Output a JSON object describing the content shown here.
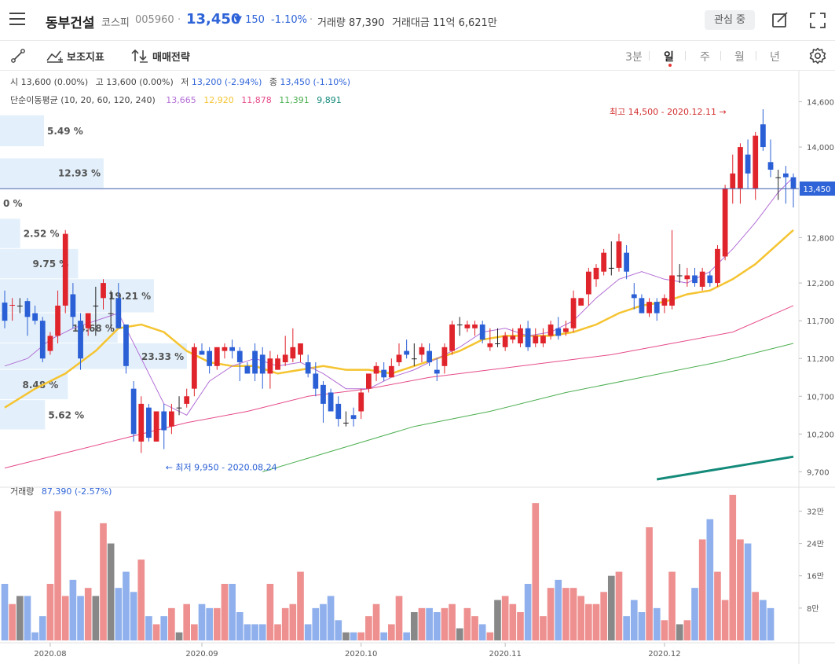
{
  "header": {
    "stock_name": "동부건설",
    "market": "코스피",
    "code": "005960",
    "separator": "·",
    "price": "13,450",
    "change": "▼ 150",
    "change_pct": "-1.10%",
    "volume": "거래량 87,390",
    "amount": "거래대금 11억 6,621만",
    "watch_label": "관심 중",
    "icons": [
      "menu-icon",
      "edit-icon",
      "fullscreen-icon"
    ]
  },
  "toolbar": {
    "indicator_label": "보조지표",
    "strategy_label": "매매전략",
    "timeframes": [
      "3분",
      "일",
      "주",
      "월",
      "년"
    ],
    "active_timeframe": "일",
    "icons": [
      "draw-line-icon",
      "indicator-icon",
      "strategy-icon",
      "gear-icon"
    ]
  },
  "info": {
    "open_label": "시",
    "open_value": "13,600 (0.00%)",
    "high_label": "고",
    "high_value": "13,600 (0.00%)",
    "low_label": "저",
    "low_value": "13,200 (-2.94%)",
    "close_label": "종",
    "close_value": "13,450 (-1.10%)",
    "ma_label": "단순이동평균 (10, 20, 60, 120, 240)",
    "ma_values": [
      {
        "value": "13,665",
        "color": "#b36fd6"
      },
      {
        "value": "12,920",
        "color": "#f5c431"
      },
      {
        "value": "11,878",
        "color": "#e64b8a"
      },
      {
        "value": "11,391",
        "color": "#4caf50"
      },
      {
        "value": "9,891",
        "color": "#138a7a"
      }
    ]
  },
  "volume_panel": {
    "label": "거래량",
    "value": "87,390 (-2.57%)"
  },
  "chart_data": {
    "type": "candlestick",
    "ylim": [
      9600,
      14750
    ],
    "price_ticks": [
      {
        "value": 9700,
        "label": "9,700"
      },
      {
        "value": 10200,
        "label": "10,200"
      },
      {
        "value": 10700,
        "label": "10,700"
      },
      {
        "value": 11200,
        "label": "11,200"
      },
      {
        "value": 11700,
        "label": "11,700"
      },
      {
        "value": 12200,
        "label": "12,200"
      },
      {
        "value": 12800,
        "label": "12,800"
      },
      {
        "value": 14000,
        "label": "14,000"
      },
      {
        "value": 14600,
        "label": "14,600"
      }
    ],
    "current_price": {
      "value": 13450,
      "label": "13,450",
      "color": "#2f64d8"
    },
    "high_annotation": {
      "text": "최고 14,500 - 2020.12.11 →",
      "index": 96
    },
    "low_annotation": {
      "text": "← 최저 9,950 - 2020.08.24",
      "index": 21
    },
    "x_labels": [
      {
        "index": 6,
        "label": "2020.08"
      },
      {
        "index": 26,
        "label": "2020.09"
      },
      {
        "index": 47,
        "label": "2020.10"
      },
      {
        "index": 66,
        "label": "2020.11"
      },
      {
        "index": 87,
        "label": "2020.12"
      }
    ],
    "volume_ticks": [
      {
        "value": 8,
        "label": "8만"
      },
      {
        "value": 16,
        "label": "16만"
      },
      {
        "value": 24,
        "label": "24만"
      },
      {
        "value": 32,
        "label": "32만"
      }
    ],
    "volume_ylim": [
      0,
      35
    ],
    "volume_profile": [
      {
        "label": "5.49 %",
        "pct": 5.49,
        "low": 14000,
        "high": 14420
      },
      {
        "label": "12.93 %",
        "pct": 12.93,
        "low": 13450,
        "high": 13850
      },
      {
        "label": "0 %",
        "pct": 0,
        "low": 13050,
        "high": 13450
      },
      {
        "label": "2.52 %",
        "pct": 2.52,
        "low": 12650,
        "high": 13050
      },
      {
        "label": "9.75 %",
        "pct": 9.75,
        "low": 12250,
        "high": 12650
      },
      {
        "label": "19.21 %",
        "pct": 19.21,
        "low": 11800,
        "high": 12250
      },
      {
        "label": "14.68 %",
        "pct": 14.68,
        "low": 11400,
        "high": 11800
      },
      {
        "label": "23.33 %",
        "pct": 23.33,
        "low": 11050,
        "high": 11400
      },
      {
        "label": "8.48 %",
        "pct": 8.48,
        "low": 10650,
        "high": 11050
      },
      {
        "label": "5.62 %",
        "pct": 5.62,
        "low": 10250,
        "high": 10650
      }
    ],
    "candles": [
      [
        11940,
        12100,
        11600,
        11700
      ],
      [
        11900,
        12000,
        11700,
        11910
      ],
      [
        11900,
        12000,
        11800,
        11900
      ],
      [
        11960,
        12000,
        11500,
        11750
      ],
      [
        11800,
        11900,
        11650,
        11700
      ],
      [
        11700,
        11750,
        11150,
        11200
      ],
      [
        11300,
        11550,
        11250,
        11500
      ],
      [
        11500,
        12100,
        11400,
        11900
      ],
      [
        11900,
        12900,
        11800,
        12850
      ],
      [
        12050,
        12200,
        11600,
        11750
      ],
      [
        11700,
        11800,
        11050,
        11200
      ],
      [
        11600,
        11800,
        11500,
        11800
      ],
      [
        11900,
        12150,
        11500,
        11900
      ],
      [
        12000,
        12250,
        11850,
        12200
      ],
      [
        11800,
        12100,
        11600,
        11800
      ],
      [
        12000,
        12200,
        11600,
        11600
      ],
      [
        11650,
        11650,
        11000,
        11100
      ],
      [
        10800,
        10900,
        10100,
        10200
      ],
      [
        10100,
        10700,
        9950,
        10600
      ],
      [
        10550,
        10600,
        10100,
        10150
      ],
      [
        10100,
        10500,
        10100,
        10500
      ],
      [
        10500,
        10600,
        10000,
        10250
      ],
      [
        10300,
        10600,
        10200,
        10500
      ],
      [
        10550,
        10700,
        10450,
        10550
      ],
      [
        10600,
        10800,
        10550,
        10700
      ],
      [
        10800,
        11400,
        10700,
        11350
      ],
      [
        11300,
        11400,
        11250,
        11250
      ],
      [
        11300,
        11350,
        11000,
        11100
      ],
      [
        11100,
        11350,
        11050,
        11350
      ],
      [
        11300,
        11400,
        11200,
        11350
      ],
      [
        11350,
        11450,
        11200,
        11300
      ],
      [
        11300,
        11350,
        10900,
        11150
      ],
      [
        11100,
        11150,
        11000,
        11000
      ],
      [
        11300,
        11400,
        10900,
        11000
      ],
      [
        11250,
        11350,
        10800,
        11000
      ],
      [
        11000,
        11300,
        10800,
        11200
      ],
      [
        11050,
        11250,
        11050,
        11200
      ],
      [
        11150,
        11500,
        11100,
        11250
      ],
      [
        11200,
        11600,
        11150,
        11350
      ],
      [
        11250,
        11400,
        11150,
        11400
      ],
      [
        11150,
        11250,
        10950,
        11000
      ],
      [
        11000,
        11150,
        10700,
        10800
      ],
      [
        10850,
        10900,
        10350,
        10600
      ],
      [
        10750,
        10800,
        10500,
        10500
      ],
      [
        10600,
        10700,
        10300,
        10400
      ],
      [
        10350,
        10500,
        10300,
        10350
      ],
      [
        10450,
        10550,
        10300,
        10400
      ],
      [
        10500,
        10800,
        10400,
        10750
      ],
      [
        10800,
        11000,
        10750,
        11000
      ],
      [
        11000,
        11150,
        10900,
        11100
      ],
      [
        11050,
        11150,
        10900,
        10950
      ],
      [
        10950,
        11200,
        10950,
        11100
      ],
      [
        11150,
        11400,
        11100,
        11250
      ],
      [
        11300,
        11450,
        11200,
        11250
      ],
      [
        11200,
        11400,
        11100,
        11200
      ],
      [
        11250,
        11400,
        11150,
        11350
      ],
      [
        11300,
        11400,
        11100,
        11150
      ],
      [
        11050,
        11200,
        10900,
        11000
      ],
      [
        11100,
        11400,
        11000,
        11350
      ],
      [
        11300,
        11700,
        11250,
        11650
      ],
      [
        11650,
        11750,
        11500,
        11650
      ],
      [
        11600,
        11700,
        11550,
        11650
      ],
      [
        11600,
        11700,
        11500,
        11650
      ],
      [
        11650,
        11700,
        11400,
        11450
      ],
      [
        11350,
        11600,
        11300,
        11400
      ],
      [
        11400,
        11600,
        11350,
        11400
      ],
      [
        11350,
        11550,
        11300,
        11500
      ],
      [
        11450,
        11600,
        11400,
        11500
      ],
      [
        11400,
        11650,
        11350,
        11600
      ],
      [
        11600,
        11700,
        11300,
        11350
      ],
      [
        11400,
        11600,
        11350,
        11500
      ],
      [
        11400,
        11600,
        11350,
        11500
      ],
      [
        11500,
        11700,
        11450,
        11650
      ],
      [
        11600,
        11750,
        11450,
        11500
      ],
      [
        11550,
        11700,
        11500,
        11600
      ],
      [
        11600,
        12100,
        11550,
        12000
      ],
      [
        11900,
        12000,
        11900,
        12000
      ],
      [
        12050,
        12400,
        11900,
        12350
      ],
      [
        12250,
        12450,
        12150,
        12400
      ],
      [
        12350,
        12650,
        12300,
        12600
      ],
      [
        12400,
        12750,
        12300,
        12400
      ],
      [
        12400,
        12850,
        12350,
        12750
      ],
      [
        12600,
        12700,
        12250,
        12350
      ],
      [
        12050,
        12200,
        11850,
        12000
      ],
      [
        12000,
        12050,
        11800,
        11800
      ],
      [
        11800,
        12000,
        11750,
        11950
      ],
      [
        11950,
        12000,
        11700,
        11800
      ],
      [
        11900,
        12050,
        11800,
        12000
      ],
      [
        11900,
        12900,
        11850,
        12300
      ],
      [
        12300,
        12450,
        12200,
        12300
      ],
      [
        12250,
        12400,
        12150,
        12300
      ],
      [
        12300,
        12400,
        12150,
        12200
      ],
      [
        12150,
        12400,
        12100,
        12350
      ],
      [
        12300,
        12350,
        12150,
        12200
      ],
      [
        12200,
        12700,
        12150,
        12650
      ],
      [
        12550,
        13500,
        12500,
        13450
      ],
      [
        13450,
        13900,
        13250,
        13650
      ],
      [
        13450,
        14050,
        13250,
        14000
      ],
      [
        13900,
        14100,
        13450,
        13650
      ],
      [
        13450,
        14200,
        13300,
        14150
      ],
      [
        14300,
        14500,
        13950,
        14000
      ],
      [
        13800,
        14100,
        13600,
        13700
      ],
      [
        13600,
        13700,
        13300,
        13600
      ],
      [
        13650,
        13750,
        13250,
        13600
      ],
      [
        13600,
        13650,
        13200,
        13450
      ]
    ],
    "volume": [
      14,
      9,
      11,
      11,
      2,
      6,
      14,
      32,
      11,
      15,
      11,
      13,
      11,
      29,
      24,
      13,
      17,
      12,
      20,
      6,
      4,
      6,
      8,
      2,
      9,
      4,
      9,
      8,
      8,
      14,
      14,
      7,
      4,
      4,
      4,
      14,
      4,
      8,
      9,
      17,
      4,
      8,
      9,
      11,
      5,
      2,
      2,
      2,
      6,
      9,
      2,
      4,
      11,
      2,
      7,
      8,
      8,
      7,
      8,
      9,
      3,
      8,
      6,
      4,
      2,
      10,
      11,
      9,
      7,
      14,
      34,
      6,
      13,
      15,
      13,
      13,
      11,
      9,
      9,
      12,
      16,
      17,
      6,
      10,
      7,
      28,
      8,
      5,
      17,
      4,
      5,
      13,
      25,
      30,
      17,
      10,
      36,
      25,
      24,
      12,
      10,
      8
    ],
    "ma5_path": [
      [
        0,
        11100
      ],
      [
        3,
        11200
      ],
      [
        6,
        11450
      ],
      [
        9,
        11600
      ],
      [
        12,
        11700
      ],
      [
        15,
        11800
      ],
      [
        18,
        11200
      ],
      [
        21,
        10600
      ],
      [
        24,
        10450
      ],
      [
        27,
        10900
      ],
      [
        30,
        11100
      ],
      [
        33,
        11200
      ],
      [
        36,
        11100
      ],
      [
        39,
        11150
      ],
      [
        42,
        11000
      ],
      [
        45,
        10800
      ],
      [
        48,
        10800
      ],
      [
        51,
        10950
      ],
      [
        54,
        11050
      ],
      [
        57,
        11200
      ],
      [
        60,
        11350
      ],
      [
        63,
        11550
      ],
      [
        66,
        11600
      ],
      [
        69,
        11500
      ],
      [
        72,
        11550
      ],
      [
        75,
        11700
      ],
      [
        78,
        12000
      ],
      [
        81,
        12250
      ],
      [
        84,
        12350
      ],
      [
        87,
        12250
      ],
      [
        90,
        12200
      ],
      [
        93,
        12350
      ],
      [
        96,
        12650
      ],
      [
        99,
        13000
      ],
      [
        102,
        13400
      ],
      [
        104,
        13600
      ]
    ],
    "ma20_path": [
      [
        0,
        10550
      ],
      [
        4,
        10800
      ],
      [
        8,
        11000
      ],
      [
        12,
        11300
      ],
      [
        15,
        11600
      ],
      [
        18,
        11650
      ],
      [
        21,
        11550
      ],
      [
        24,
        11300
      ],
      [
        27,
        11150
      ],
      [
        30,
        11100
      ],
      [
        33,
        11100
      ],
      [
        36,
        11000
      ],
      [
        39,
        11050
      ],
      [
        42,
        11100
      ],
      [
        45,
        11050
      ],
      [
        48,
        11050
      ],
      [
        51,
        11000
      ],
      [
        54,
        11100
      ],
      [
        57,
        11200
      ],
      [
        60,
        11300
      ],
      [
        63,
        11450
      ],
      [
        66,
        11500
      ],
      [
        69,
        11500
      ],
      [
        72,
        11500
      ],
      [
        75,
        11550
      ],
      [
        78,
        11650
      ],
      [
        81,
        11800
      ],
      [
        84,
        11900
      ],
      [
        87,
        11950
      ],
      [
        90,
        12050
      ],
      [
        93,
        12100
      ],
      [
        96,
        12250
      ],
      [
        99,
        12450
      ],
      [
        104,
        12900
      ]
    ],
    "ma60_path": [
      [
        0,
        9750
      ],
      [
        8,
        9950
      ],
      [
        16,
        10150
      ],
      [
        24,
        10350
      ],
      [
        32,
        10500
      ],
      [
        40,
        10700
      ],
      [
        48,
        10800
      ],
      [
        56,
        10950
      ],
      [
        64,
        11050
      ],
      [
        72,
        11150
      ],
      [
        80,
        11250
      ],
      [
        88,
        11400
      ],
      [
        96,
        11550
      ],
      [
        104,
        11900
      ]
    ],
    "ma120_path": [
      [
        34,
        9700
      ],
      [
        44,
        10000
      ],
      [
        54,
        10300
      ],
      [
        64,
        10500
      ],
      [
        74,
        10750
      ],
      [
        84,
        10950
      ],
      [
        94,
        11150
      ],
      [
        104,
        11400
      ]
    ],
    "ma240_path": [
      [
        86,
        9600
      ],
      [
        92,
        9700
      ],
      [
        98,
        9800
      ],
      [
        104,
        9900
      ]
    ]
  }
}
